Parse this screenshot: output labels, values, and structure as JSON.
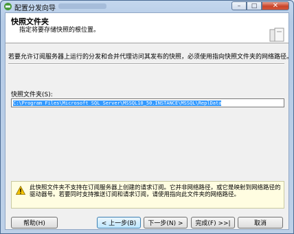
{
  "window": {
    "title": "配置分发向导"
  },
  "header": {
    "title": "快照文件夹",
    "subtitle": "指定将要存储快照的根位置。"
  },
  "main": {
    "description": "若要允许订阅服务器上运行的分发和合并代理访问其发布的快照，必须使用指向快照文件夹的网络路径。",
    "folder_label": "快照文件夹(S):",
    "folder_value": "C:\\Program Files\\Microsoft SQL Server\\MSSQL10_50.INSTANCE\\MSSQL\\ReplData"
  },
  "warning": {
    "text": "此快照文件夹不支持在订阅服务器上创建的请求订阅。它并非网络路径，或它是映射到网络路径的驱动器号。若要同时支持推送订阅和请求订阅，请使用指向此文件夹的网络路径。"
  },
  "buttons": {
    "help": "帮助(H)",
    "back": "< 上一步(B)",
    "next": "下一步(N) >",
    "finish": "完成(F) >>|",
    "cancel": "取消"
  },
  "colors": {
    "selection": "#3399ff",
    "warning_bg": "#fffde1"
  }
}
